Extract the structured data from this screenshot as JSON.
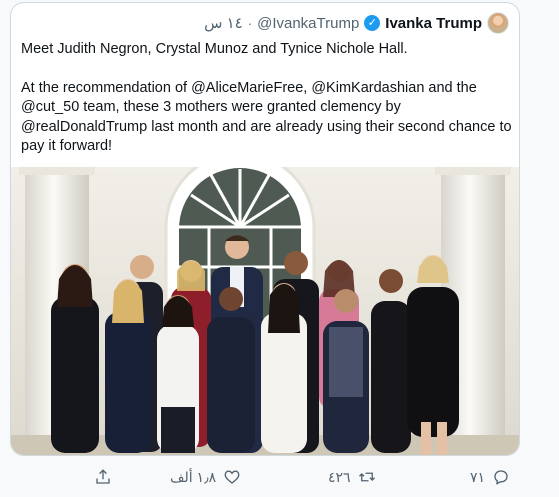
{
  "tweet": {
    "display_name": "Ivanka Trump",
    "handle": "@IvankaTrump",
    "separator": "·",
    "time": "١٤ س",
    "paragraph_1": "Meet Judith Negron, Crystal Munoz and Tynice Nichole Hall.",
    "paragraph_2": "At the recommendation of @AliceMarieFree, @KimKardashian and the @cut_50 team, these 3 mothers were granted clemency by @realDonaldTrump last month and are already using their second chance to pay it forward!"
  },
  "actions": {
    "replies": "٧١",
    "retweets": "٤٢٦",
    "likes": "١٫٨ ألف"
  },
  "colors": {
    "accent": "#1d9bf0",
    "muted": "#536471",
    "border": "#cfd9de"
  },
  "icons": [
    "verified-badge-icon",
    "reply-icon",
    "retweet-icon",
    "like-icon",
    "share-icon"
  ]
}
